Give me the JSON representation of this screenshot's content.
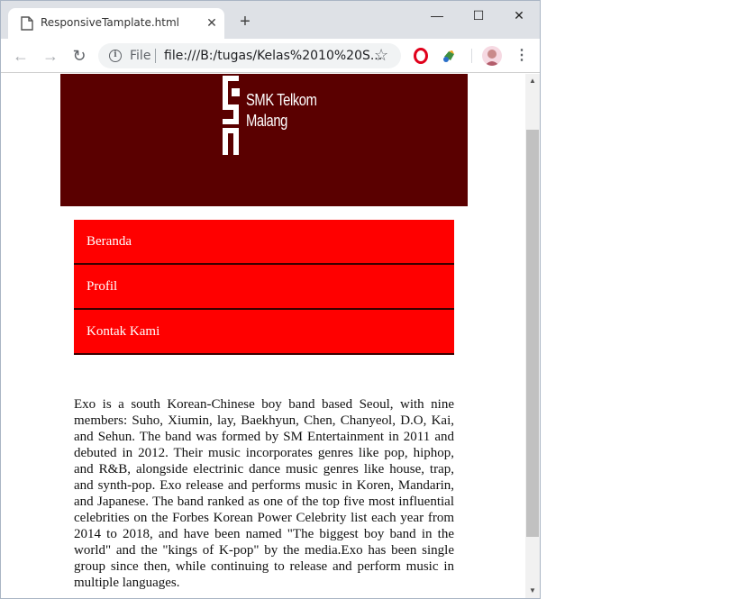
{
  "browser": {
    "tab_title": "ResponsiveTamplate.html",
    "close_tab_glyph": "✕",
    "new_tab_glyph": "+",
    "minimize_glyph": "—",
    "maximize_glyph": "☐",
    "close_glyph": "✕",
    "back_glyph": "←",
    "forward_glyph": "→",
    "reload_glyph": "↻",
    "scheme_label": "File",
    "url": "file:///B:/tugas/Kelas%2010%20S...",
    "star_glyph": "☆",
    "menu_glyph": "⋮"
  },
  "page": {
    "logo_line1": "SMK Telkom",
    "logo_line2": "Malang",
    "nav_items": [
      {
        "label": "Beranda"
      },
      {
        "label": "Profil"
      },
      {
        "label": "Kontak Kami"
      }
    ],
    "article_text": "Exo is a south Korean-Chinese boy band based Seoul, with nine members: Suho, Xiumin, lay, Baekhyun, Chen, Chanyeol, D.O, Kai, and Sehun. The band was formed by SM Entertainment in 2011 and debuted in 2012. Their music incorporates genres like pop, hiphop, and R&B, alongside electrinic dance music genres like house, trap, and synth-pop. Exo release and performs music in Koren, Mandarin, and Japanese. The band ranked as one of the top five most influential celebrities on the Forbes Korean Power Celebrity list each year from 2014 to 2018, and have been named \"The biggest boy band in the world\" and the \"kings of K-pop\" by the media.Exo has been single group since then, while continuing to release and perform music in multiple languages."
  },
  "colors": {
    "header_bg": "#5a0000",
    "nav_bg": "#ff0000",
    "nav_text": "#ffffff"
  }
}
